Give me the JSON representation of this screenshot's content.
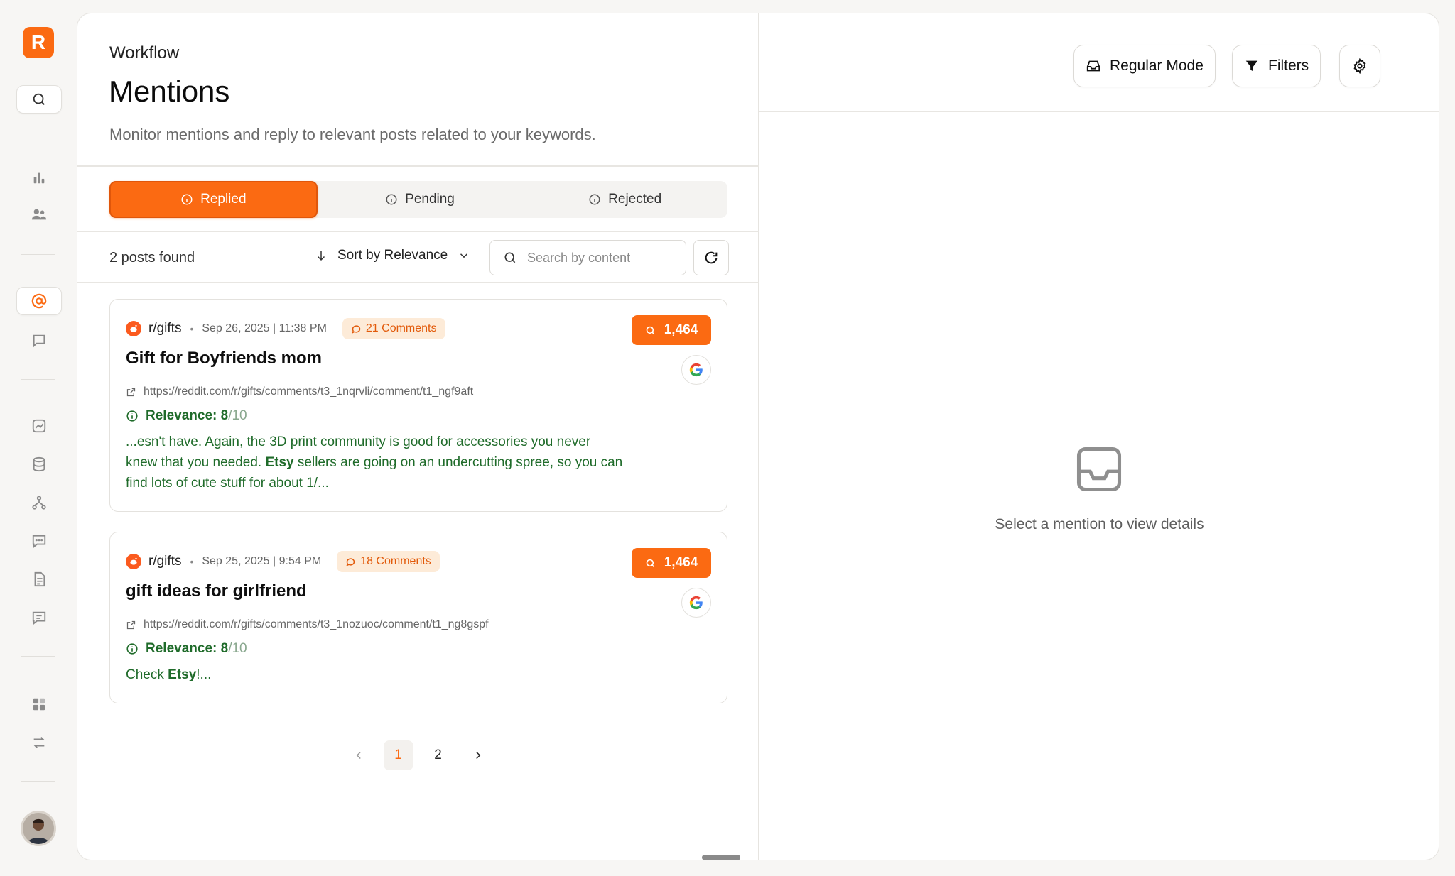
{
  "app": {
    "logo_letter": "R",
    "accent": "#fb6a12"
  },
  "sidebar": {
    "items": [
      {
        "icon": "search-icon"
      },
      {
        "icon": "bar-chart-icon"
      },
      {
        "icon": "users-icon"
      },
      {
        "icon": "at-sign-icon",
        "active": true
      },
      {
        "icon": "chat-bubble-icon"
      },
      {
        "icon": "trend-chart-icon"
      },
      {
        "icon": "database-icon"
      },
      {
        "icon": "flow-icon"
      },
      {
        "icon": "message-dots-icon"
      },
      {
        "icon": "document-icon"
      },
      {
        "icon": "message-lines-icon"
      },
      {
        "icon": "grid-icon"
      },
      {
        "icon": "transfer-icon"
      }
    ]
  },
  "header": {
    "breadcrumb": "Workflow",
    "title": "Mentions",
    "subtitle": "Monitor mentions and reply to relevant posts related to your keywords."
  },
  "tabs": [
    {
      "label": "Replied",
      "active": true
    },
    {
      "label": "Pending",
      "active": false
    },
    {
      "label": "Rejected",
      "active": false
    }
  ],
  "toolbar": {
    "count_label": "2 posts found",
    "sort_label": "Sort by Relevance",
    "search_placeholder": "Search by content"
  },
  "posts": [
    {
      "subreddit": "r/gifts",
      "date": "Sep 26, 2025 | 11:38 PM",
      "comments": "21 Comments",
      "title": "Gift for Boyfriends mom",
      "url": "https://reddit.com/r/gifts/comments/t3_1nqrvli/comment/t1_ngf9aft",
      "relevance_label": "Relevance: 8",
      "relevance_max": "/10",
      "snippet_before": "...esn't have. Again, the 3D print community is good for accessories you never knew that you needed. ",
      "snippet_keyword": "Etsy",
      "snippet_after": " sellers are going on an undercutting spree, so you can find lots of cute stuff for about 1/...",
      "score": "1,464"
    },
    {
      "subreddit": "r/gifts",
      "date": "Sep 25, 2025 | 9:54 PM",
      "comments": "18 Comments",
      "title": "gift ideas for girlfriend",
      "url": "https://reddit.com/r/gifts/comments/t3_1nozuoc/comment/t1_ng8gspf",
      "relevance_label": "Relevance: 8",
      "relevance_max": "/10",
      "snippet_before": "Check ",
      "snippet_keyword": "Etsy",
      "snippet_after": "!...",
      "score": "1,464"
    }
  ],
  "pagination": {
    "pages": [
      "1",
      "2"
    ],
    "current": "1"
  },
  "right_panel": {
    "mode_label": "Regular Mode",
    "filters_label": "Filters",
    "empty_text": "Select a mention to view details"
  }
}
